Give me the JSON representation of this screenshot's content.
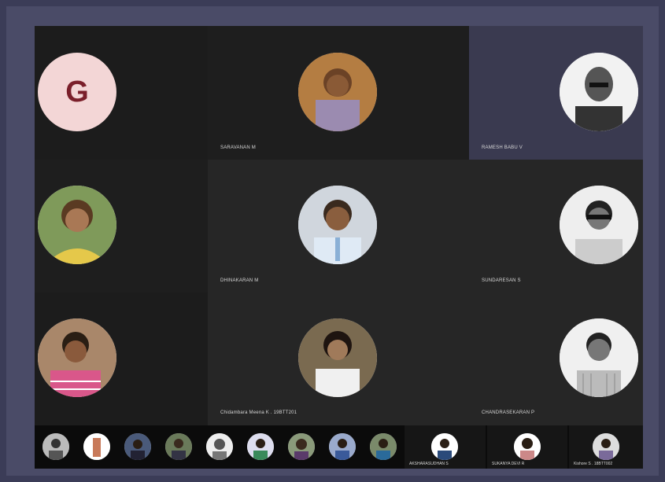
{
  "tiles": [
    {
      "name": "",
      "initial": "G"
    },
    {
      "name": "SARAVANAN M"
    },
    {
      "name": "RAMESH BABU V"
    },
    {
      "name": ""
    },
    {
      "name": "DHINAKARAN M"
    },
    {
      "name": "SUNDARESAN S"
    },
    {
      "name": ""
    },
    {
      "name": "Chidambara Meena K . 19BTT201"
    },
    {
      "name": "CHANDRASEKARAN P"
    }
  ],
  "strip_named": [
    {
      "name": "AKSHARASUDHAN S"
    },
    {
      "name": "SUKANYA DEVI R"
    },
    {
      "name": "Kishore S . 18BTT002"
    }
  ],
  "colors": {
    "frame": "#4a4b67",
    "tile_dark": "#1e1e1e",
    "tile_mid": "#262626",
    "tile_active": "#3a3a50",
    "initial_bg": "#f3d6d6",
    "initial_fg": "#7a1f2a"
  }
}
